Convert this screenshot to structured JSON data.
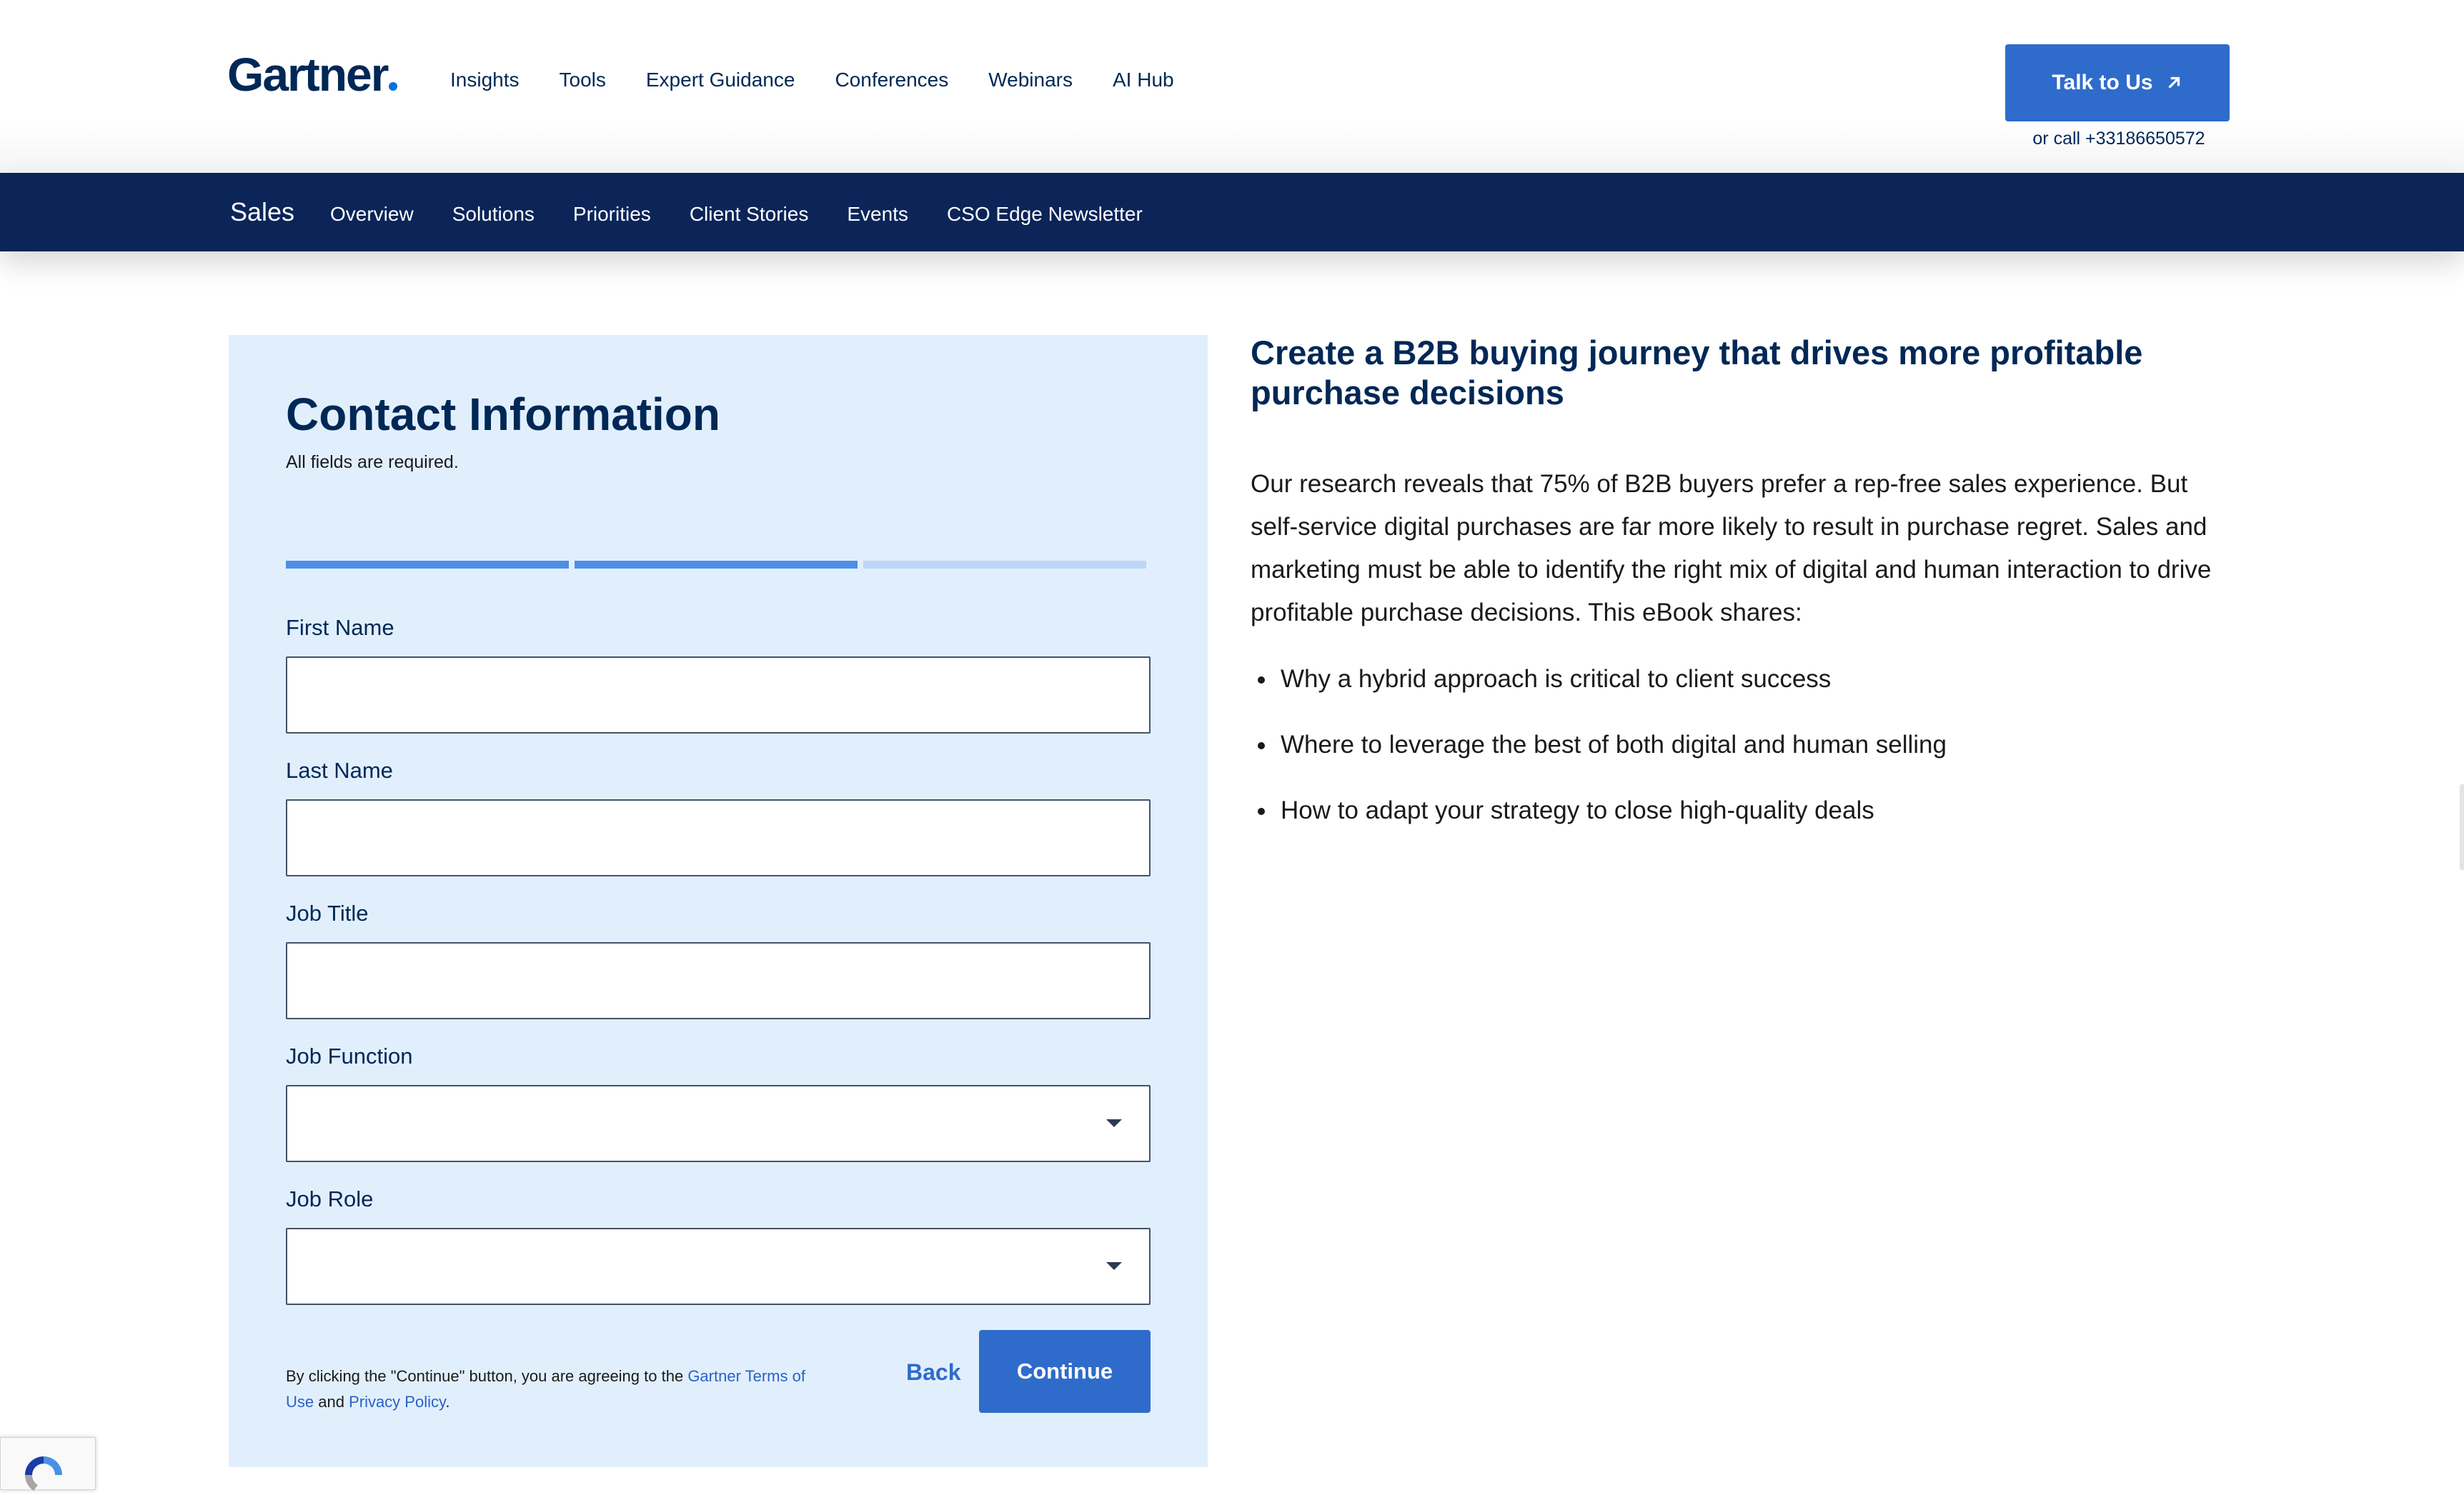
{
  "header": {
    "logo": "Gartner",
    "nav": [
      "Insights",
      "Tools",
      "Expert Guidance",
      "Conferences",
      "Webinars",
      "AI Hub"
    ],
    "cta_label": "Talk to Us",
    "call_text": "or call +33186650572"
  },
  "subnav": {
    "title": "Sales",
    "links": [
      "Overview",
      "Solutions",
      "Priorities",
      "Client Stories",
      "Events",
      "CSO Edge Newsletter"
    ]
  },
  "form": {
    "title": "Contact Information",
    "subtitle": "All fields are required.",
    "progress": {
      "current_step": 2,
      "total_steps": 3
    },
    "fields": [
      {
        "label": "First Name",
        "value": ""
      },
      {
        "label": "Last Name",
        "value": ""
      },
      {
        "label": "Job Title",
        "value": ""
      },
      {
        "label": "Job Function",
        "value": ""
      },
      {
        "label": "Job Role",
        "value": ""
      }
    ],
    "legal": {
      "prefix": "By clicking the \"Continue\" button, you are agreeing to the ",
      "terms": "Gartner Terms of Use",
      "middle": " and ",
      "privacy": "Privacy Policy",
      "suffix": "."
    },
    "back_label": "Back",
    "continue_label": "Continue"
  },
  "content": {
    "title": "Create a B2B buying journey that drives more profitable purchase decisions",
    "paragraph": "Our research reveals that 75% of B2B buyers prefer a rep-free sales experience. But self-service digital purchases are far more likely to result in purchase regret. Sales and marketing must be able to identify the right mix of digital and human interaction to drive profitable purchase decisions. This eBook shares:",
    "bullets": [
      "Why a hybrid approach is critical to client success",
      "Where to leverage the best of both digital and human selling",
      "How to adapt your strategy to close high-quality deals"
    ]
  },
  "colors": {
    "brand_navy": "#002856",
    "subnav_bg": "#0b2559",
    "accent_blue": "#2f6bcb",
    "panel_bg": "#e1effd"
  }
}
